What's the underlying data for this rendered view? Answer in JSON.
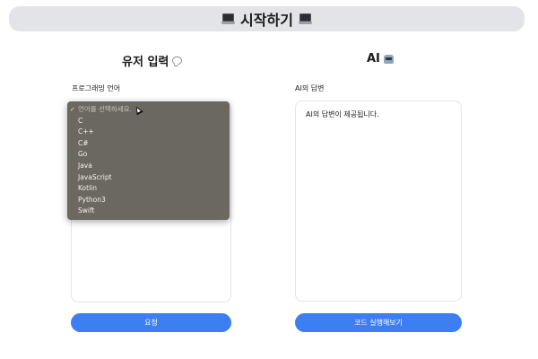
{
  "header": {
    "title": "시작하기",
    "icon": "laptop-icon"
  },
  "left": {
    "title": "유저 입력",
    "title_icon": "speech-bubble-icon",
    "language_label": "프로그래밍 언어",
    "button_label": "요청"
  },
  "right": {
    "title": "AI",
    "title_icon": "robot-icon",
    "answer_label": "AI의 답변",
    "answer_text": "AI의 답변이 제공됩니다.",
    "button_label": "코드 실행해보기"
  },
  "dropdown": {
    "placeholder": "언어를 선택하세요.",
    "selected_check": "✓",
    "options": [
      "C",
      "C++",
      "C#",
      "Go",
      "Java",
      "JavaScript",
      "Kotlin",
      "Python3",
      "Swift"
    ]
  },
  "colors": {
    "accent": "#3d7ef2",
    "header_bg": "#e3e4e8",
    "dropdown_bg": "#6b6761"
  }
}
